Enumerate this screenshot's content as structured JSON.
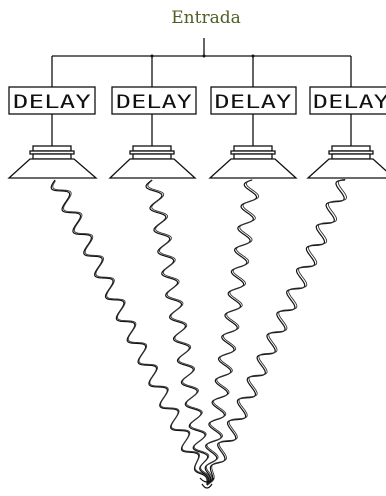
{
  "diagram": {
    "title": "Entrada",
    "channels": [
      {
        "label": "DELAY"
      },
      {
        "label": "DELAY"
      },
      {
        "label": "DELAY"
      },
      {
        "label": "DELAY"
      }
    ]
  },
  "colors": {
    "title": "#4d5f24",
    "line": "#111111",
    "background": "#ffffff"
  }
}
